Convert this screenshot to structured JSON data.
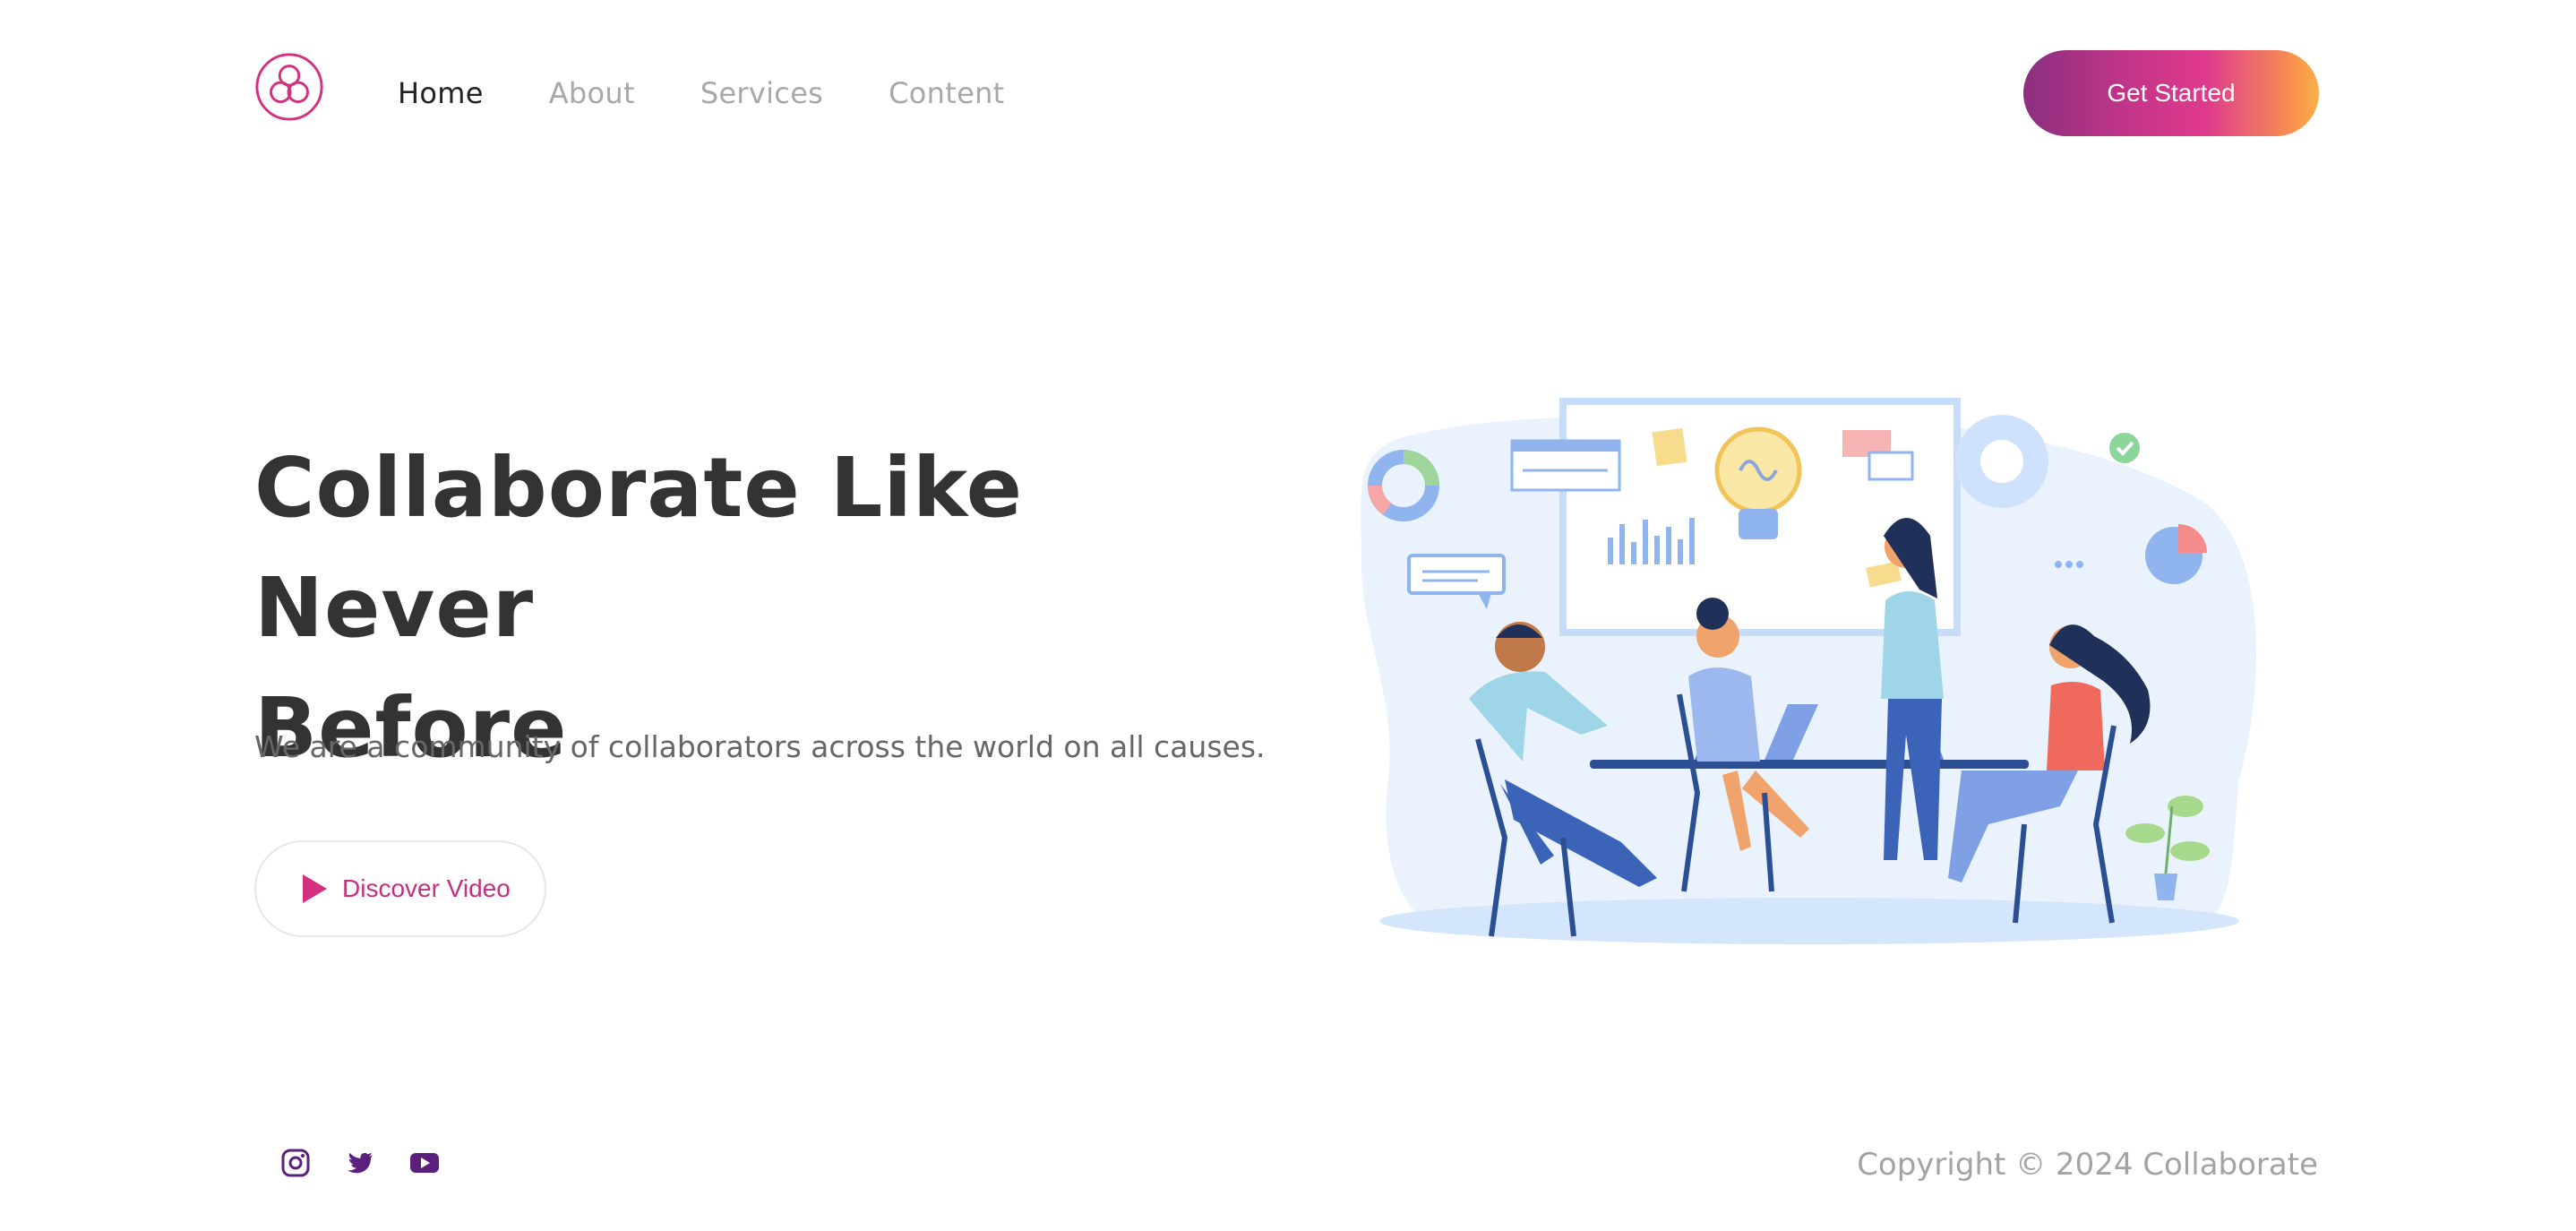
{
  "nav": {
    "items": [
      {
        "label": "Home",
        "active": true
      },
      {
        "label": "About",
        "active": false
      },
      {
        "label": "Services",
        "active": false
      },
      {
        "label": "Content",
        "active": false
      }
    ],
    "cta_label": "Get Started"
  },
  "hero": {
    "title_line1": "Collaborate Like Never",
    "title_line2": "Before",
    "subtitle": "We are a community of collaborators across the world on all causes.",
    "video_button_label": "Discover Video"
  },
  "footer": {
    "social": [
      "instagram-icon",
      "twitter-icon",
      "youtube-icon"
    ],
    "copyright": "Copyright © 2024 Collaborate"
  },
  "colors": {
    "brand_pink": "#d5307f",
    "brand_purple": "#5b1f7c",
    "accent_orange": "#f9a04c",
    "text_dark": "#333333",
    "text_muted": "#a8a8a8"
  }
}
